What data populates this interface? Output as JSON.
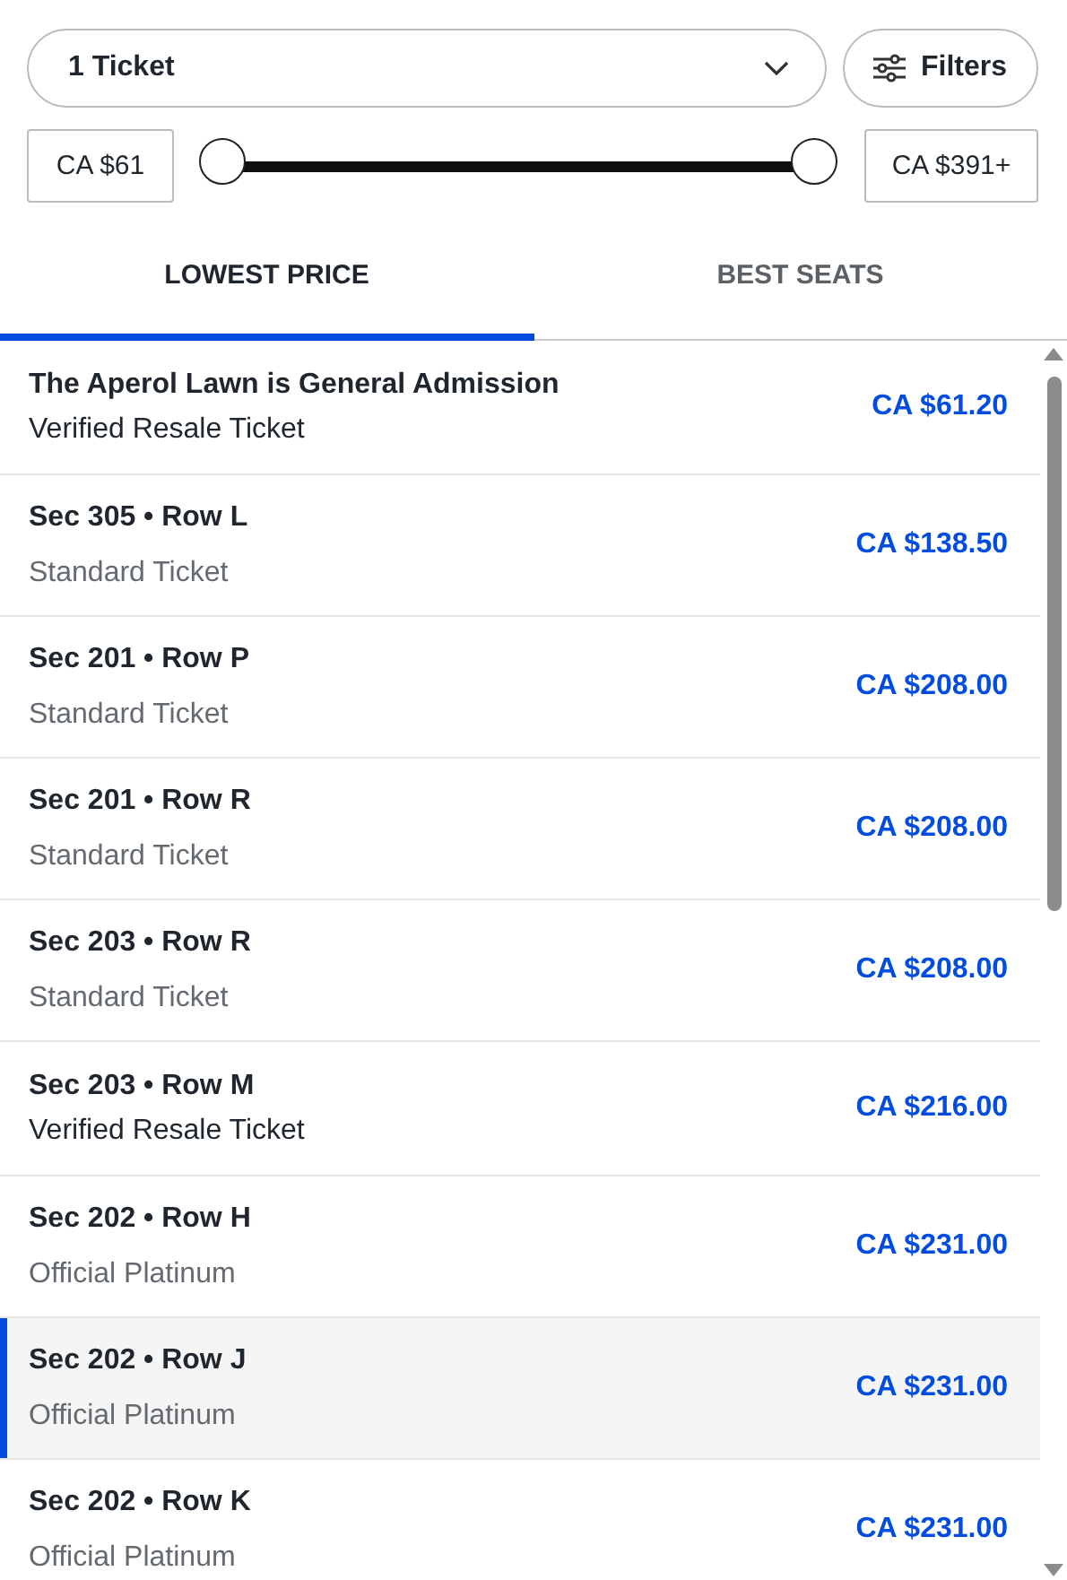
{
  "quantity_dropdown": {
    "value": "1 Ticket"
  },
  "filters_button": {
    "label": "Filters"
  },
  "price_range": {
    "min_label": "CA $61",
    "max_label": "CA $391+",
    "min_thumb": {
      "level": 0
    },
    "max_thumb": {
      "level": 1
    }
  },
  "tabs": [
    {
      "label": "LOWEST PRICE",
      "selected": true
    },
    {
      "label": "BEST SEATS",
      "selected": false
    }
  ],
  "listings": [
    {
      "title": "The Aperol Lawn is General Admission",
      "subtitle": "Verified Resale Ticket",
      "price": "CA $61.20",
      "kind": "resale",
      "selected": false
    },
    {
      "title": "Sec 305 • Row L",
      "subtitle": "Standard Ticket",
      "price": "CA $138.50",
      "kind": "standard",
      "selected": false
    },
    {
      "title": "Sec 201 • Row P",
      "subtitle": "Standard Ticket",
      "price": "CA $208.00",
      "kind": "standard",
      "selected": false
    },
    {
      "title": "Sec 201 • Row R",
      "subtitle": "Standard Ticket",
      "price": "CA $208.00",
      "kind": "standard",
      "selected": false
    },
    {
      "title": "Sec 203 • Row R",
      "subtitle": "Standard Ticket",
      "price": "CA $208.00",
      "kind": "standard",
      "selected": false
    },
    {
      "title": "Sec 203 • Row M",
      "subtitle": "Verified Resale Ticket",
      "price": "CA $216.00",
      "kind": "resale",
      "selected": false
    },
    {
      "title": "Sec 202 • Row H",
      "subtitle": "Official Platinum",
      "price": "CA $231.00",
      "kind": "standard",
      "selected": false
    },
    {
      "title": "Sec 202 • Row J",
      "subtitle": "Official Platinum",
      "price": "CA $231.00",
      "kind": "standard",
      "selected": true
    },
    {
      "title": "Sec 202 • Row K",
      "subtitle": "Official Platinum",
      "price": "CA $231.00",
      "kind": "standard",
      "selected": false
    }
  ]
}
